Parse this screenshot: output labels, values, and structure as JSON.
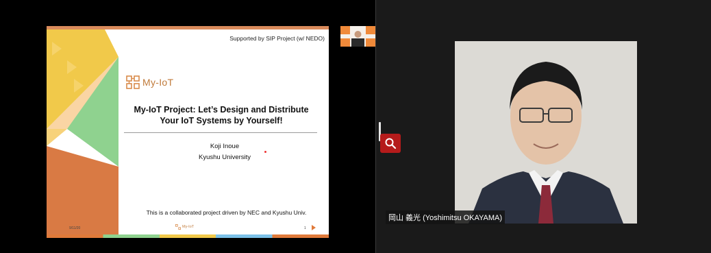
{
  "slide": {
    "supported_by": "Supported by SIP Project (w/ NEDO)",
    "logo_text": "My-IoT",
    "title_line1": "My-IoT Project: Let’s Design and Distribute",
    "title_line2": "Your IoT Systems by Yourself!",
    "author": "Koji Inoue",
    "affiliation": "Kyushu University",
    "collaboration": "This is a collaborated project driven by NEC and Kyushu Univ.",
    "date": "9/11/20",
    "footer_logo": "My-IoT",
    "page_number": "1",
    "colors": {
      "orange": "#e07a3a",
      "green": "#8fd28f",
      "yellow": "#f1c94a",
      "brand": "#c07a3a"
    }
  },
  "participant": {
    "name_label": "岡山 義光 (Yoshimitsu OKAYAMA)"
  },
  "icons": {
    "zoom": "magnifier-icon",
    "next": "arrow-right-icon"
  }
}
